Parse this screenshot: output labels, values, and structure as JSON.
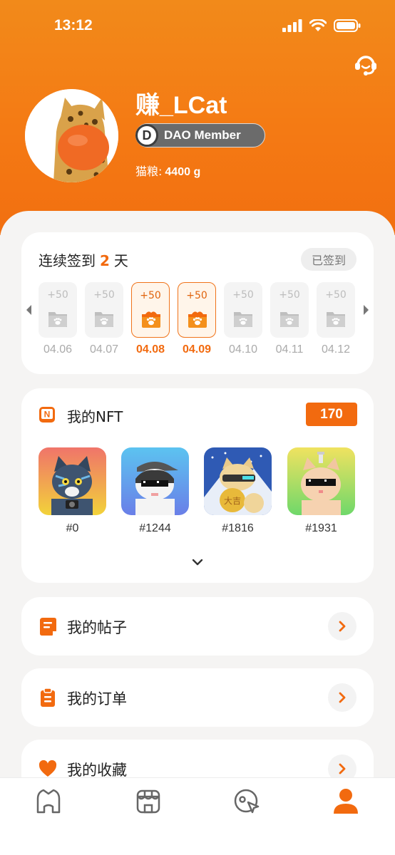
{
  "status_bar": {
    "time": "13:12"
  },
  "profile": {
    "username": "赚_LCat",
    "badge_letter": "D",
    "badge_text": "DAO Member",
    "cat_food_label": "猫粮:",
    "cat_food_value": "4400  g"
  },
  "checkin": {
    "title_prefix": "连续签到",
    "streak_days": "2",
    "title_suffix": "天",
    "status_button": "已签到",
    "days": [
      {
        "reward": "+50",
        "date": "04.06",
        "claimed": false
      },
      {
        "reward": "+50",
        "date": "04.07",
        "claimed": false
      },
      {
        "reward": "+50",
        "date": "04.08",
        "claimed": true
      },
      {
        "reward": "+50",
        "date": "04.09",
        "claimed": true
      },
      {
        "reward": "+50",
        "date": "04.10",
        "claimed": false
      },
      {
        "reward": "+50",
        "date": "04.11",
        "claimed": false
      },
      {
        "reward": "+50",
        "date": "04.12",
        "claimed": false
      }
    ]
  },
  "nft": {
    "title": "我的NFT",
    "count": "170",
    "items": [
      {
        "id": "#0"
      },
      {
        "id": "#1244"
      },
      {
        "id": "#1816"
      },
      {
        "id": "#1931"
      }
    ]
  },
  "menu": {
    "posts": "我的帖子",
    "orders": "我的订单",
    "favorites": "我的收藏"
  },
  "tabbar": {
    "icons": [
      "home-icon",
      "store-icon",
      "explore-icon",
      "profile-icon"
    ],
    "active": "profile"
  },
  "colors": {
    "accent": "#f26a0f",
    "header_top": "#f28a1a"
  }
}
